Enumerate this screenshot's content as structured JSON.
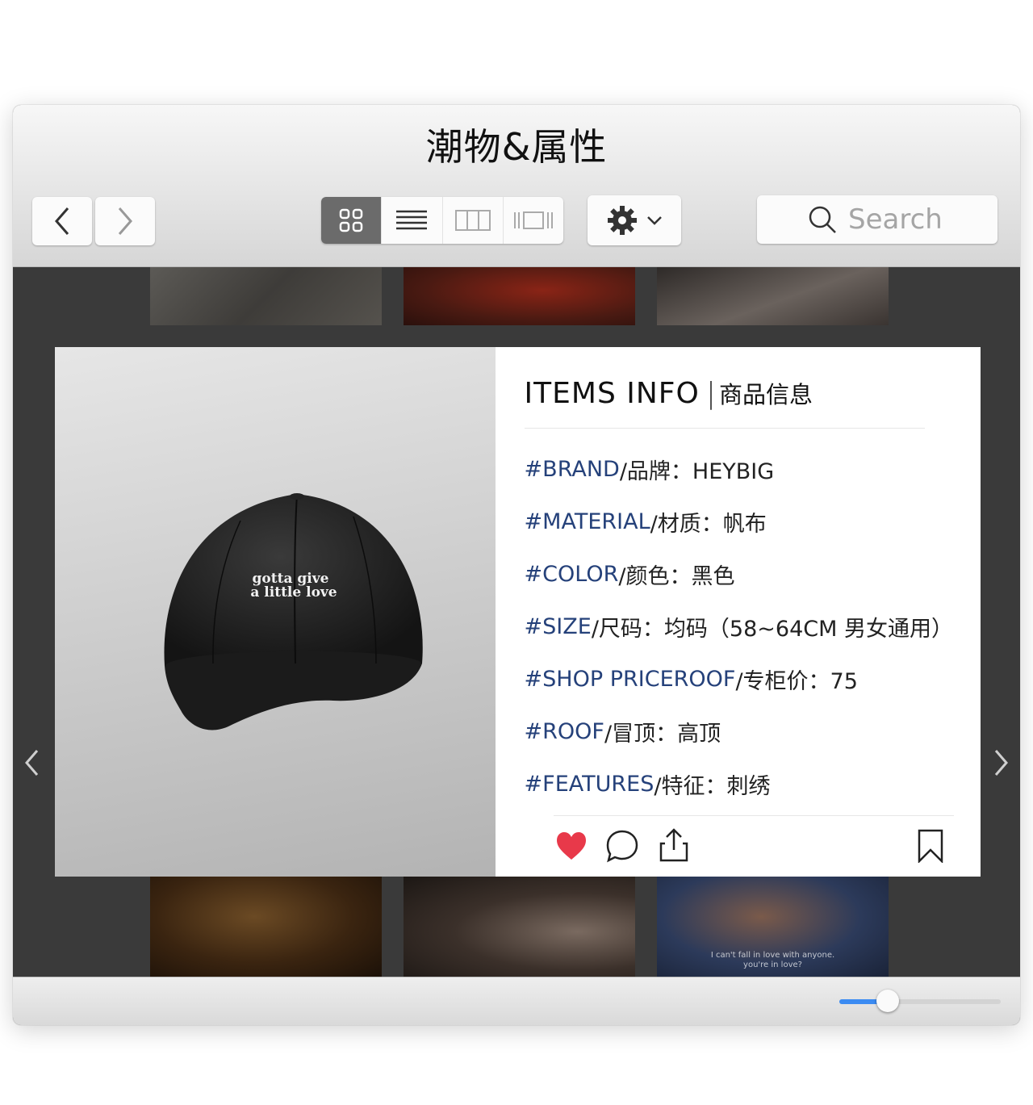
{
  "window": {
    "title": "潮物&属性"
  },
  "toolbar": {
    "back_icon": "chevron-left-icon",
    "forward_icon": "chevron-right-icon",
    "view_modes": [
      "grid-view-icon",
      "list-view-icon",
      "column-view-icon",
      "coverflow-view-icon"
    ],
    "active_view": "grid-view-icon",
    "settings_icon": "gear-icon",
    "search_placeholder": "Search"
  },
  "card": {
    "cap_text_line1": "gotta give",
    "cap_text_line2": "a little love",
    "title_en": "ITEMS INFO",
    "title_sep": "|",
    "title_cn": "商品信息",
    "rows": [
      {
        "tag": "#BRAND",
        "rest": "/品牌：HEYBIG"
      },
      {
        "tag": "#MATERIAL",
        "rest": "/材质：帆布"
      },
      {
        "tag": "#COLOR",
        "rest": "/颜色：黑色"
      },
      {
        "tag": "#SIZE",
        "rest": "/尺码：均码（58~64CM 男女通用）"
      },
      {
        "tag": "#SHOP PRICEROOF",
        "rest": "/专柜价：75"
      },
      {
        "tag": "#ROOF",
        "rest": "/冒顶：高顶"
      },
      {
        "tag": "#FEATURES",
        "rest": "/特征：刺绣"
      }
    ],
    "actions": [
      "heart-icon",
      "comment-icon",
      "share-icon",
      "bookmark-icon"
    ]
  },
  "gallery": {
    "caption_line1": "I can't fall in love with anyone.",
    "caption_line2": "you're in love?"
  },
  "footer": {
    "zoom_level": 0.3
  },
  "colors": {
    "accent": "#3b8bf2",
    "tag_blue": "#25417a",
    "heart_red": "#e8394a"
  }
}
